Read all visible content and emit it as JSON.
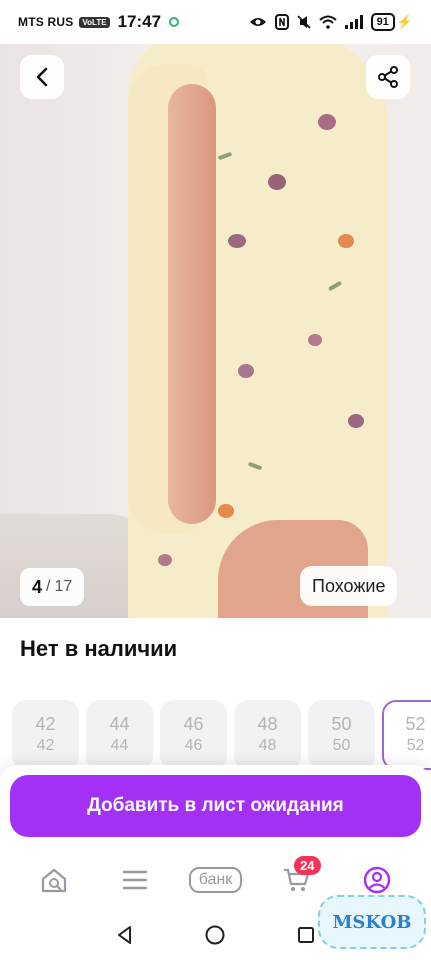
{
  "status_bar": {
    "carrier": "MTS RUS",
    "volte": "VoLTE",
    "time": "17:47",
    "battery": "91"
  },
  "gallery": {
    "current": "4",
    "separator": "/",
    "total": "17",
    "similar_label": "Похожие"
  },
  "product": {
    "availability": "Нет в наличии"
  },
  "sizes": [
    {
      "top": "42",
      "bottom": "42",
      "selected": false
    },
    {
      "top": "44",
      "bottom": "44",
      "selected": false
    },
    {
      "top": "46",
      "bottom": "46",
      "selected": false
    },
    {
      "top": "48",
      "bottom": "48",
      "selected": false
    },
    {
      "top": "50",
      "bottom": "50",
      "selected": false
    },
    {
      "top": "52",
      "bottom": "52",
      "selected": true
    }
  ],
  "actions": {
    "waitlist_label": "Добавить в лист ожидания"
  },
  "tabbar": {
    "bank_label": "банк",
    "cart_count": "24"
  },
  "watermark": "MSKOB",
  "colors": {
    "accent": "#a231f5",
    "badge": "#f2335b",
    "selected_border": "#9a6ad1"
  }
}
